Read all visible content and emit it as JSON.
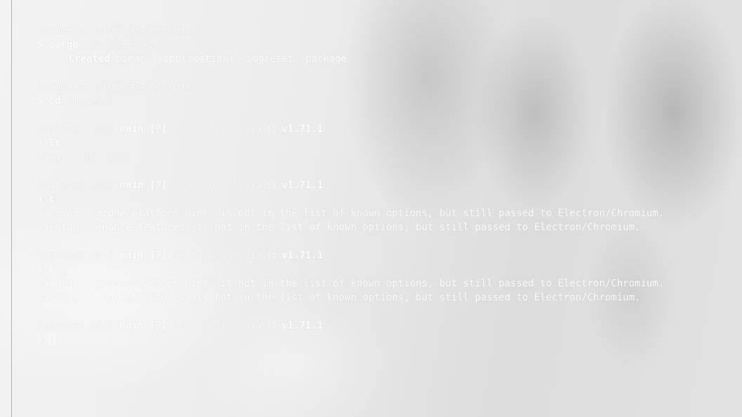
{
  "path_prompt": "Documents/projects/personal",
  "prompt_symbol": "❯",
  "cmd_cargo_new": {
    "program": "cargo",
    "args": "new imgreset"
  },
  "created_msg": {
    "keyword": "Created",
    "rest": " binary (application) `imgreset` package"
  },
  "cmd_cd": {
    "program": "cd",
    "args": "imgreset"
  },
  "status": {
    "dir": "imgreset",
    "on": "on",
    "branch_icon": "git-branch-icon",
    "branch_glyph": "ᚠ",
    "branch": "main",
    "flags": "[?]",
    "is": "is",
    "pkg_icon": "package-icon",
    "pkg_glyph": "◯",
    "pkg_version": "v0.1.0",
    "via": "via",
    "rust_icon": "rust-icon",
    "rust_glyph": "⛭",
    "rust_version": "v1.71.1"
  },
  "cmd_ls": {
    "program": "ls"
  },
  "ls_output": "Cargo.toml  src",
  "cmd_c": {
    "program": "c",
    "cursor_char": "_"
  },
  "warnings": [
    "warning: 'ozone-platform-hint' is not in the list of known options, but still passed to Electron/Chromium.",
    "warning: 'enable-features' is not in the list of known options, but still passed to Electron/Chromium."
  ]
}
